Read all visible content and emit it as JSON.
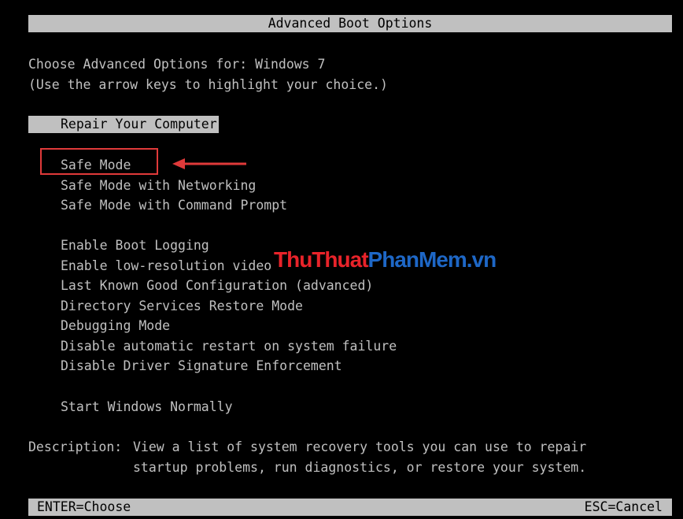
{
  "title": "Advanced Boot Options",
  "intro": {
    "line1": "Choose Advanced Options for: Windows 7",
    "line2": "(Use the arrow keys to highlight your choice.)"
  },
  "selected_option": "Repair Your Computer",
  "options_group1": [
    "Safe Mode",
    "Safe Mode with Networking",
    "Safe Mode with Command Prompt"
  ],
  "options_group2": [
    "Enable Boot Logging",
    "Enable low-resolution video",
    "Last Known Good Configuration (advanced)",
    "Directory Services Restore Mode",
    "Debugging Mode",
    "Disable automatic restart on system failure",
    "Disable Driver Signature Enforcement"
  ],
  "options_group3": [
    "Start Windows Normally"
  ],
  "description": {
    "label": "Description:",
    "line1": "View a list of system recovery tools you can use to repair",
    "line2": "startup problems, run diagnostics, or restore your system."
  },
  "footer": {
    "left": "ENTER=Choose",
    "right": "ESC=Cancel"
  },
  "annotation": {
    "color": "#e03a3a"
  },
  "watermark": {
    "part1": "ThuThuat",
    "part2": "PhanMem",
    "part3": ".vn"
  }
}
